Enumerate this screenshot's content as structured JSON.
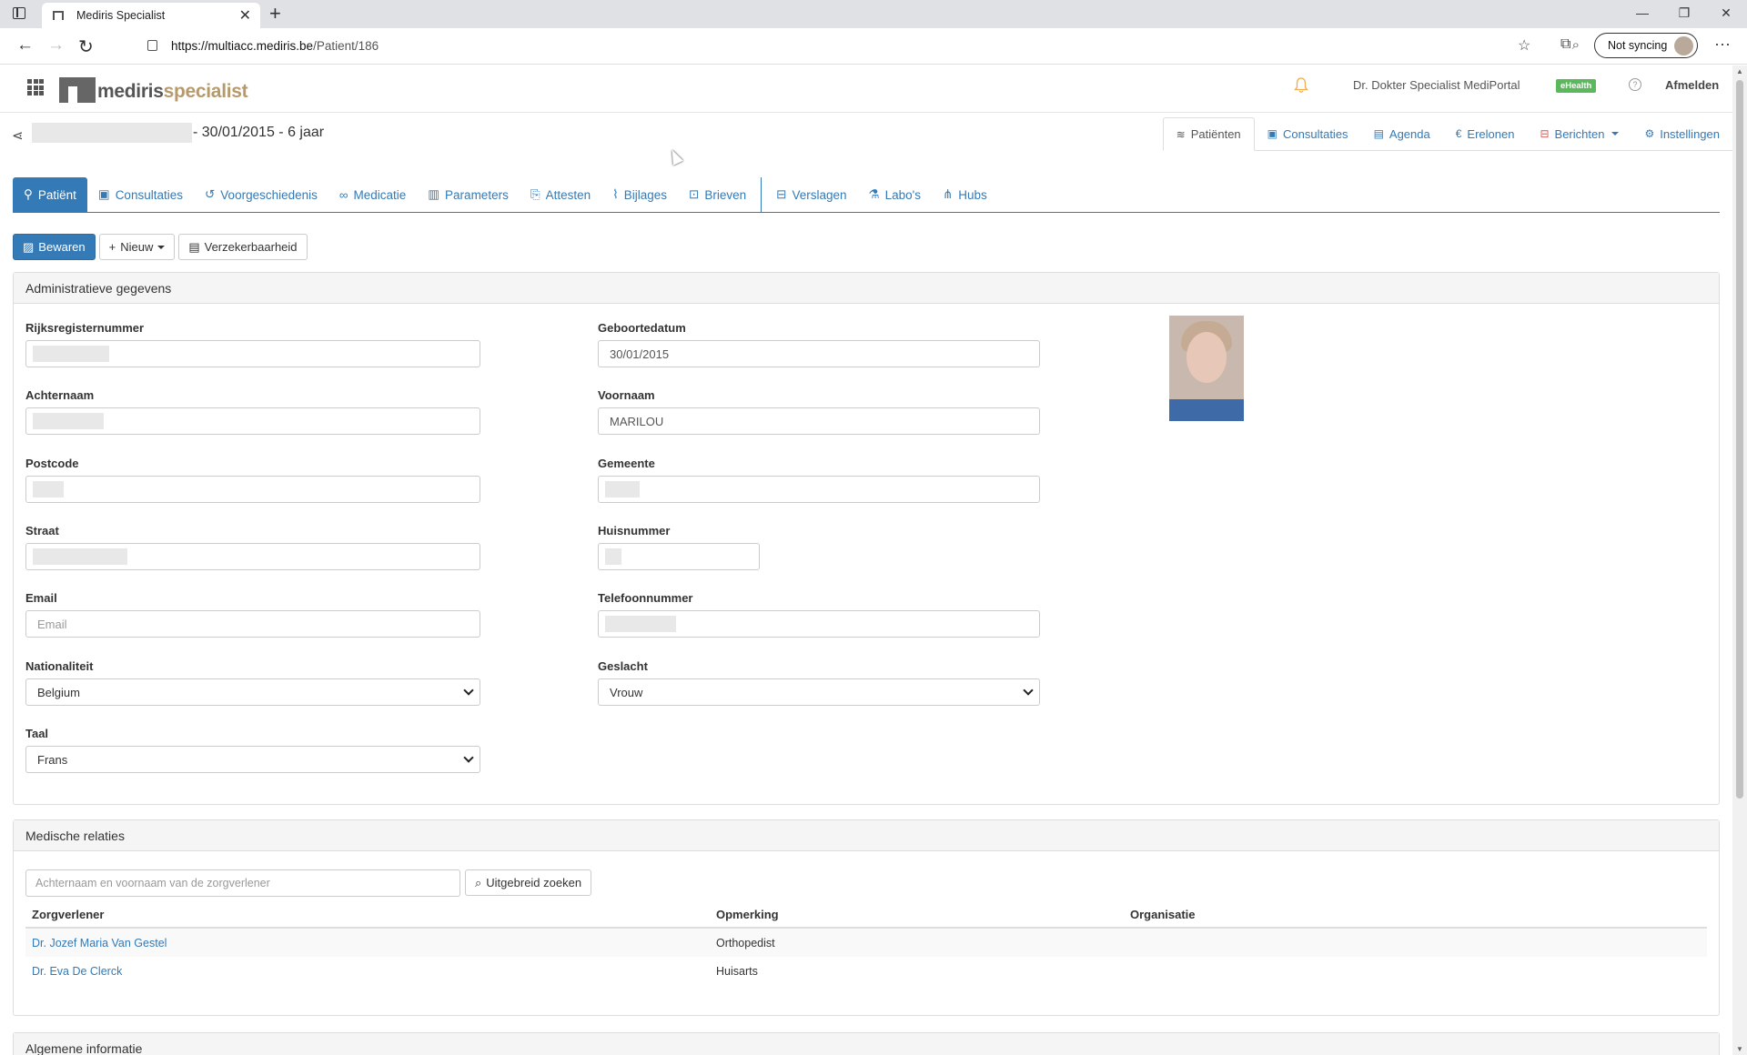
{
  "browser": {
    "tab_title": "Mediris Specialist",
    "url_domain": "https://multiacc.mediris.be",
    "url_path": "/Patient/186",
    "sync_label": "Not syncing"
  },
  "header": {
    "logo_part1": "mediris",
    "logo_part2": "specialist",
    "doctor_name": "Dr. Dokter Specialist MediPortal",
    "ehealth_badge": "eHealth",
    "logout_label": "Afmelden"
  },
  "patient": {
    "info": "- 30/01/2015 - 6 jaar"
  },
  "top_nav": [
    {
      "label": "Patiënten",
      "icon": "patients-icon"
    },
    {
      "label": "Consultaties",
      "icon": "briefcase-icon"
    },
    {
      "label": "Agenda",
      "icon": "calendar-icon"
    },
    {
      "label": "Erelonen",
      "icon": "euro-icon"
    },
    {
      "label": "Berichten",
      "icon": "inbox-icon"
    },
    {
      "label": "Instellingen",
      "icon": "gear-icon"
    }
  ],
  "sub_tabs": [
    {
      "label": "Patiënt"
    },
    {
      "label": "Consultaties"
    },
    {
      "label": "Voorgeschiedenis"
    },
    {
      "label": "Medicatie"
    },
    {
      "label": "Parameters"
    },
    {
      "label": "Attesten"
    },
    {
      "label": "Bijlages"
    },
    {
      "label": "Brieven"
    },
    {
      "label": "Verslagen"
    },
    {
      "label": "Labo's"
    },
    {
      "label": "Hubs"
    }
  ],
  "toolbar": {
    "save": "Bewaren",
    "new": "Nieuw",
    "insurability": "Verzekerbaarheid"
  },
  "admin": {
    "title": "Administratieve gegevens",
    "rijksregister_label": "Rijksregisternummer",
    "geboortedatum_label": "Geboortedatum",
    "geboortedatum_value": "30/01/2015",
    "achternaam_label": "Achternaam",
    "voornaam_label": "Voornaam",
    "voornaam_value": "MARILOU",
    "postcode_label": "Postcode",
    "gemeente_label": "Gemeente",
    "straat_label": "Straat",
    "huisnummer_label": "Huisnummer",
    "email_label": "Email",
    "email_placeholder": "Email",
    "telefoon_label": "Telefoonnummer",
    "nationaliteit_label": "Nationaliteit",
    "nationaliteit_value": "Belgium",
    "geslacht_label": "Geslacht",
    "geslacht_value": "Vrouw",
    "taal_label": "Taal",
    "taal_value": "Frans"
  },
  "relations": {
    "title": "Medische relaties",
    "search_placeholder": "Achternaam en voornaam van de zorgverlener",
    "search_button": "Uitgebreid zoeken",
    "columns": [
      "Zorgverlener",
      "Opmerking",
      "Organisatie"
    ],
    "rows": [
      {
        "name": "Dr. Jozef Maria Van Gestel",
        "remark": "Orthopedist",
        "org": ""
      },
      {
        "name": "Dr. Eva De Clerck",
        "remark": "Huisarts",
        "org": ""
      }
    ]
  },
  "general": {
    "title": "Algemene informatie"
  }
}
